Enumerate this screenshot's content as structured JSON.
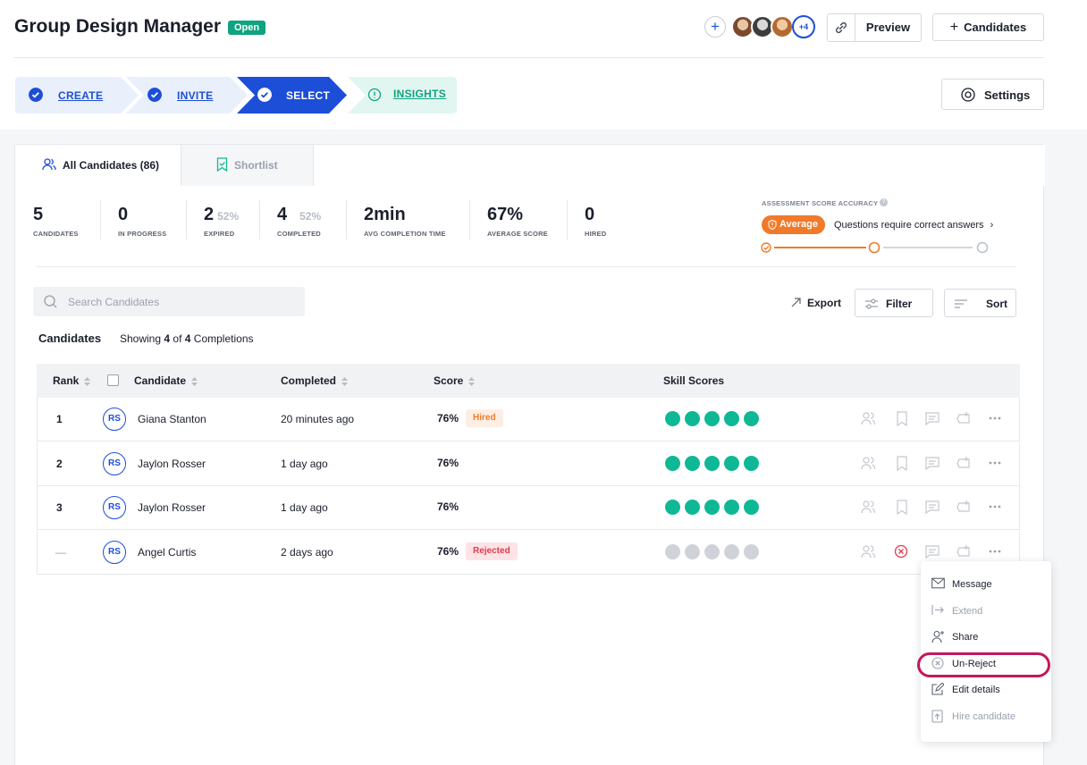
{
  "header": {
    "title": "Group Design Manager",
    "status_badge": "Open",
    "add_collaborator": "+",
    "more_collaborators": "+4",
    "preview_label": "Preview",
    "candidates_button_label": "Candidates"
  },
  "stepper": {
    "steps": [
      {
        "label": "CREATE",
        "state": "done"
      },
      {
        "label": "INVITE",
        "state": "done"
      },
      {
        "label": "SELECT",
        "state": "active"
      },
      {
        "label": "INSIGHTS",
        "state": "pending"
      }
    ],
    "settings_label": "Settings"
  },
  "tabs": {
    "all_candidates": "All Candidates (86)",
    "shortlist": "Shortlist"
  },
  "stats": [
    {
      "value": "5",
      "label": "CANDIDATES"
    },
    {
      "value": "0",
      "label": "IN PROGRESS"
    },
    {
      "value": "2",
      "pct": "52%",
      "label": "EXPIRED"
    },
    {
      "value": "4",
      "pct": "52%",
      "label": "COMPLETED"
    },
    {
      "value": "2min",
      "label": "AVG COMPLETION TIME"
    },
    {
      "value": "67%",
      "label": "AVERAGE SCORE"
    },
    {
      "value": "0",
      "label": "HIRED"
    }
  ],
  "accuracy": {
    "title": "ASSESSMENT SCORE ACCURACY",
    "help": "?",
    "level": "Average",
    "description": "Questions require correct answers",
    "slider_position": 1,
    "slider_steps": 3
  },
  "toolbar": {
    "search_placeholder": "Search Candidates",
    "export_label": "Export",
    "filter_label": "Filter",
    "sort_label": "Sort"
  },
  "candidates_section": {
    "heading": "Candidates",
    "showing_prefix": "Showing",
    "showing_count": "4",
    "showing_of": "of",
    "showing_total": "4",
    "showing_suffix": "Completions"
  },
  "table": {
    "columns": {
      "rank": "Rank",
      "candidate": "Candidate",
      "completed": "Completed",
      "score": "Score",
      "skill_scores": "Skill Scores"
    },
    "rows": [
      {
        "rank": "1",
        "initials": "RS",
        "name": "Giana Stanton",
        "completed": "20 minutes ago",
        "score": "76%",
        "badge": "Hired",
        "skills_active": true
      },
      {
        "rank": "2",
        "initials": "RS",
        "name": "Jaylon Rosser",
        "completed": "1 day ago",
        "score": "76%",
        "badge": "",
        "skills_active": true
      },
      {
        "rank": "3",
        "initials": "RS",
        "name": "Jaylon Rosser",
        "completed": "1 day ago",
        "score": "76%",
        "badge": "",
        "skills_active": true
      },
      {
        "rank": "—",
        "initials": "RS",
        "name": "Angel Curtis",
        "completed": "2 days ago",
        "score": "76%",
        "badge": "Rejected",
        "skills_active": false
      }
    ]
  },
  "row_menu": {
    "items": [
      {
        "label": "Message",
        "icon": "mail-icon",
        "enabled": true
      },
      {
        "label": "Extend",
        "icon": "extend-arrow-icon",
        "enabled": false
      },
      {
        "label": "Share",
        "icon": "user-plus-icon",
        "enabled": true
      },
      {
        "label": "Un-Reject",
        "icon": "circle-x-icon",
        "enabled": false
      },
      {
        "label": "Edit details",
        "icon": "edit-icon",
        "enabled": true
      },
      {
        "label": "Hire candidate",
        "icon": "upload-doc-icon",
        "enabled": false
      }
    ],
    "highlighted": "Un-Reject"
  },
  "colors": {
    "primary": "#1d4ed8",
    "teal": "#0fb894",
    "orange": "#f07a29",
    "rejected": "#e23a4b",
    "highlight": "#c2185b"
  }
}
